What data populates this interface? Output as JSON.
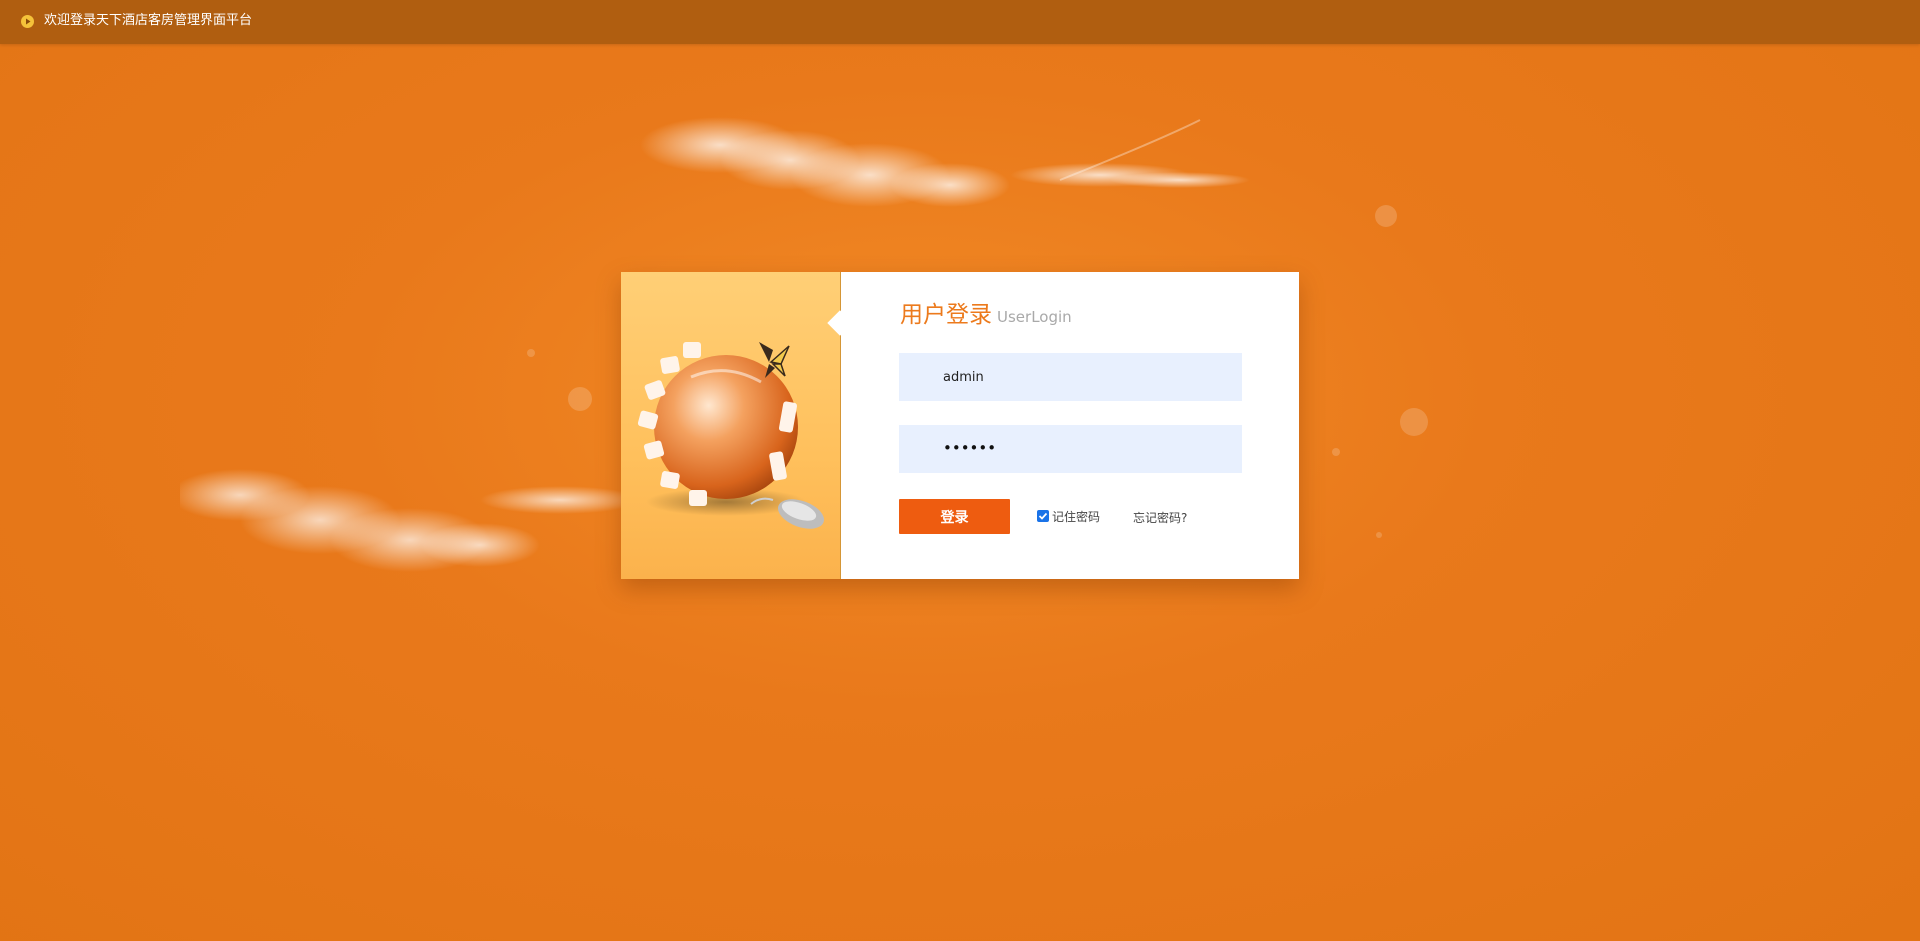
{
  "topbar": {
    "title": "欢迎登录天下酒店客房管理界面平台",
    "icon": "play-circle-icon"
  },
  "login": {
    "title_cn": "用户登录",
    "title_en": "UserLogin",
    "username_value": "admin",
    "password_mask": "••••••",
    "login_button": "登录",
    "remember_label": "记住密码",
    "remember_checked": true,
    "forgot_link": "忘记密码?"
  },
  "colors": {
    "background": "#e9791b",
    "topbar": "#b05e10",
    "accent": "#ee5c10",
    "title": "#ec7a1c",
    "input_bg": "#e8f0fe"
  }
}
